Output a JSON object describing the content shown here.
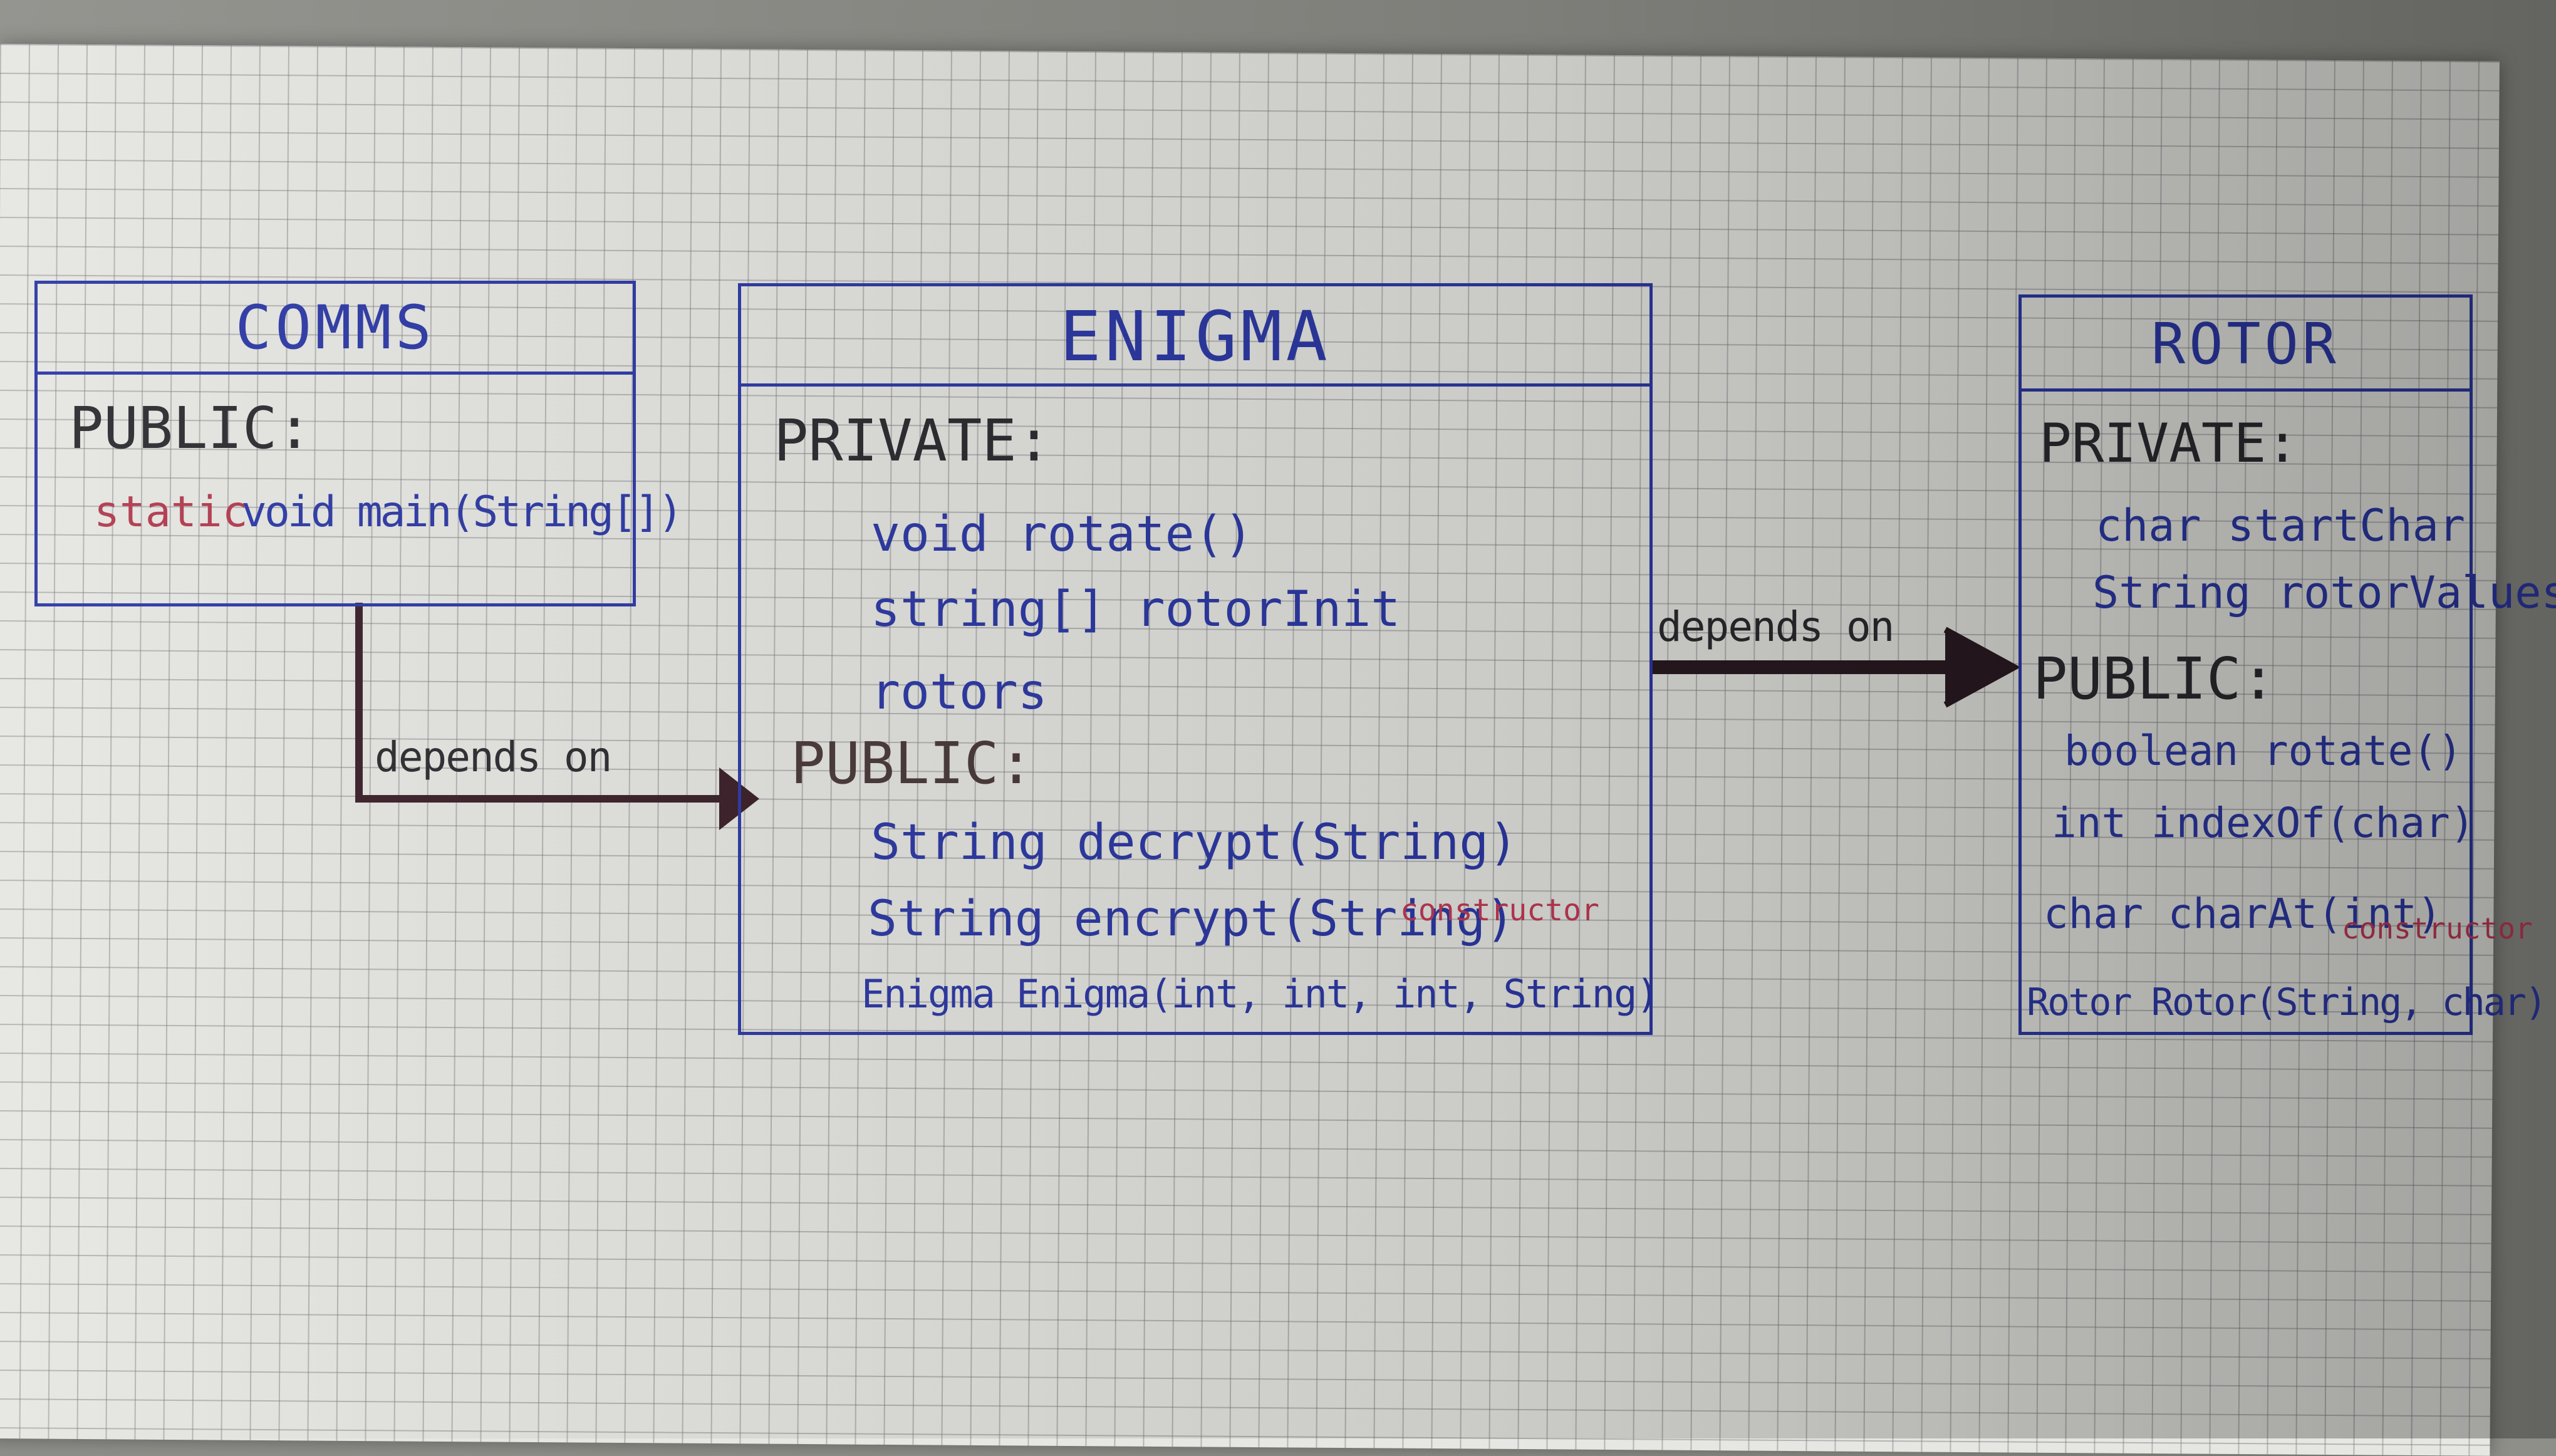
{
  "comms": {
    "name": "COMMS",
    "public_label": "PUBLIC:",
    "public_modifier": "static",
    "public_method": "void main(String[])"
  },
  "enigma": {
    "name": "ENIGMA",
    "private_label": "PRIVATE:",
    "private_members": [
      "void rotate()",
      "string[] rotorInit",
      "rotors"
    ],
    "public_label": "PUBLIC:",
    "public_members": [
      "String decrypt(String)",
      "String encrypt(String)",
      "Enigma Enigma(int, int, int, String)"
    ],
    "constructor_note": "constructor"
  },
  "rotor": {
    "name": "ROTOR",
    "private_label": "PRIVATE:",
    "private_members": [
      "char startChar",
      "String rotorValues"
    ],
    "public_label": "PUBLIC:",
    "public_members": [
      "boolean rotate()",
      "int indexOf(char)",
      "char charAt(int)",
      "Rotor Rotor(String, char)"
    ],
    "constructor_note": "constructor"
  },
  "relations": [
    {
      "from": "COMMS",
      "to": "ENIGMA",
      "label": "depends on"
    },
    {
      "from": "ENIGMA",
      "to": "ROTOR",
      "label": "depends on"
    }
  ],
  "colors": {
    "ink_blue": "#2c39a6",
    "ink_dark": "#2b2b30",
    "ink_red": "#c23a55",
    "arrow": "#3a1f28"
  }
}
